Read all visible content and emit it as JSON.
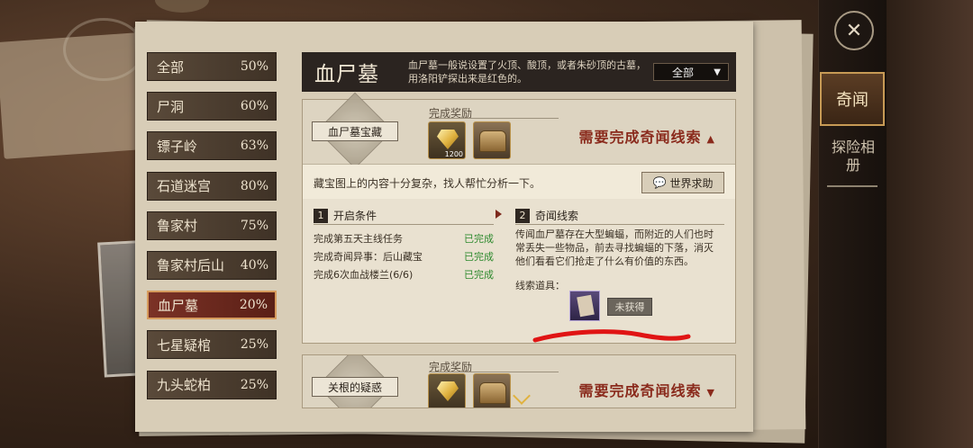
{
  "sidebar": {
    "items": [
      {
        "name": "全部",
        "pct": "50%"
      },
      {
        "name": "尸洞",
        "pct": "60%"
      },
      {
        "name": "镖子岭",
        "pct": "63%"
      },
      {
        "name": "石道迷宫",
        "pct": "80%"
      },
      {
        "name": "鲁家村",
        "pct": "75%"
      },
      {
        "name": "鲁家村后山",
        "pct": "40%"
      },
      {
        "name": "血尸墓",
        "pct": "20%"
      },
      {
        "name": "七星疑棺",
        "pct": "25%"
      },
      {
        "name": "九头蛇柏",
        "pct": "25%"
      }
    ],
    "active_index": 6
  },
  "header": {
    "title": "血尸墓",
    "desc": "血尸墓一般说设置了火顶、酸顶，或者朱砂顶的古墓，用洛阳铲探出来是红色的。",
    "filter_label": "全部"
  },
  "card1": {
    "badge": "血尸墓宝藏",
    "reward_title": "完成奖励",
    "reward_count": "1200",
    "need_text": "需要完成奇闻线索",
    "treasure_text": "藏宝图上的内容十分复杂，找人帮忙分析一下。",
    "help_button": "世界求助",
    "section1_num": "1",
    "section1_title": "开启条件",
    "conditions": [
      {
        "text": "完成第五天主线任务",
        "status": "已完成"
      },
      {
        "text": "完成奇闻异事：后山藏宝",
        "status": "已完成"
      },
      {
        "text": "完成6次血战楼兰(6/6)",
        "status": "已完成"
      }
    ],
    "section2_num": "2",
    "section2_title": "奇闻线索",
    "clue_text": "传闻血尸墓存在大型蝙蝠，而附近的人们也时常丢失一些物品，前去寻找蝙蝠的下落，消灭他们看看它们抢走了什么有价值的东西。",
    "clue_item_label": "线索道具：",
    "not_obtained": "未获得"
  },
  "card2": {
    "badge": "关根的疑惑",
    "reward_title": "完成奖励",
    "need_text": "需要完成奇闻线索"
  },
  "right_nav": {
    "close_icon": "close-icon",
    "tab_active": "奇闻",
    "tab2": "探险相册"
  },
  "colors": {
    "accent_red": "#8a2a1c",
    "done_green": "#2f8a2f",
    "annotation_red": "#e01414"
  }
}
